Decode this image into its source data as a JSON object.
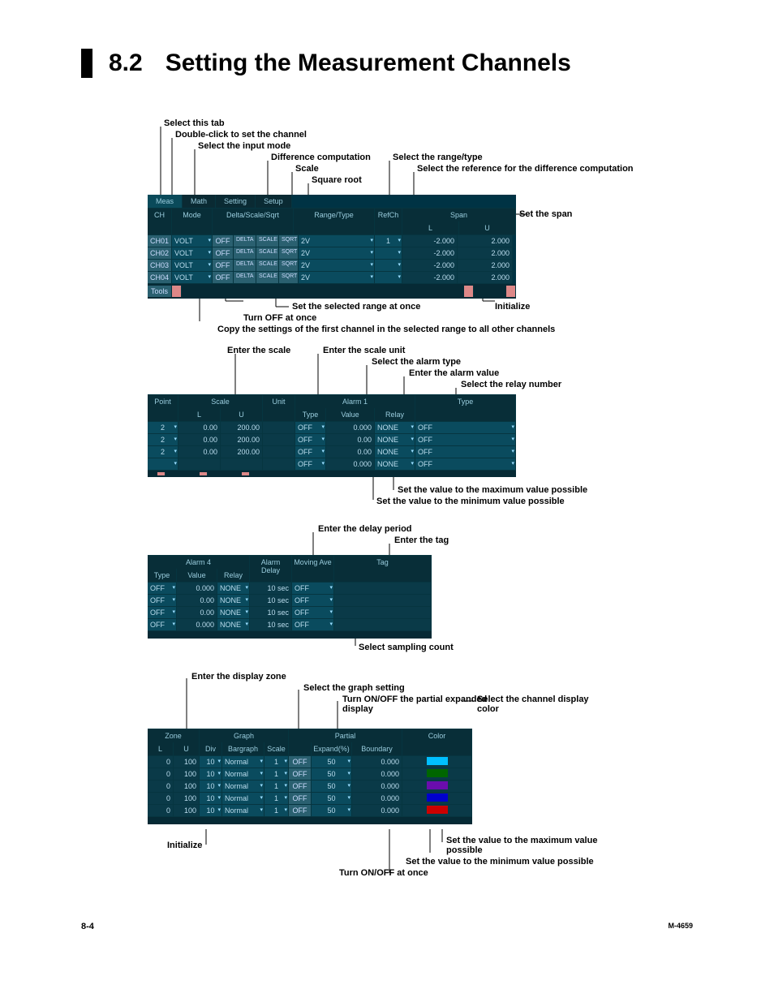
{
  "page": {
    "section_number": "8.2",
    "section_title": "Setting the Measurement Channels",
    "footer_left": "8-4",
    "footer_right": "M-4659"
  },
  "block1": {
    "annos": {
      "select_tab": "Select this tab",
      "dbl_click": "Double-click to set the channel",
      "input_mode": "Select the input mode",
      "diff_comp": "Difference computation",
      "scale": "Scale",
      "sqrt": "Square root",
      "range_type": "Select the range/type",
      "ref_diff": "Select the reference for the difference computation",
      "set_span": "Set the span",
      "set_sel_range": "Set the selected range at once",
      "turn_off": "Turn OFF at once",
      "copy": "Copy the settings of the first channel in the selected range to all other channels",
      "initialize": "Initialize"
    },
    "tabs": [
      "Meas",
      "Math",
      "Setting",
      "Setup"
    ],
    "headers": {
      "ch": "CH",
      "mode": "Mode",
      "delta": "Delta/Scale/Sqrt",
      "range": "Range/Type",
      "refch": "RefCh",
      "span": "Span",
      "span_l": "L",
      "span_u": "U"
    },
    "rows": [
      {
        "ch": "CH01",
        "mode": "VOLT",
        "off": "OFF",
        "delta": "DELTA",
        "scale": "SCALE",
        "sqrt": "SQRT",
        "range": "2V",
        "refch": "1",
        "l": "-2.000",
        "u": "2.000"
      },
      {
        "ch": "CH02",
        "mode": "VOLT",
        "off": "OFF",
        "delta": "DELTA",
        "scale": "SCALE",
        "sqrt": "SQRT",
        "range": "2V",
        "refch": "",
        "l": "-2.000",
        "u": "2.000"
      },
      {
        "ch": "CH03",
        "mode": "VOLT",
        "off": "OFF",
        "delta": "DELTA",
        "scale": "SCALE",
        "sqrt": "SQRT",
        "range": "2V",
        "refch": "",
        "l": "-2.000",
        "u": "2.000"
      },
      {
        "ch": "CH04",
        "mode": "VOLT",
        "off": "OFF",
        "delta": "DELTA",
        "scale": "SCALE",
        "sqrt": "SQRT",
        "range": "2V",
        "refch": "",
        "l": "-2.000",
        "u": "2.000"
      }
    ]
  },
  "block2": {
    "annos": {
      "enter_scale": "Enter the scale",
      "enter_unit": "Enter the scale unit",
      "alarm_type": "Select the alarm type",
      "alarm_value": "Enter the alarm value",
      "relay_num": "Select the relay number",
      "max_val": "Set the value to the maximum value possible",
      "min_val": "Set the value to the minimum value possible"
    },
    "headers": {
      "point": "Point",
      "scale": "Scale",
      "unit": "Unit",
      "alarm1": "Alarm 1",
      "l": "L",
      "u": "U",
      "type": "Type",
      "value": "Value",
      "relay": "Relay",
      "type2": "Type"
    },
    "rows": [
      {
        "pt": "2",
        "l": "0.00",
        "u": "200.00",
        "unit": "",
        "a1t": "OFF",
        "a1v": "0.000",
        "a1r": "NONE",
        "a2t": "OFF"
      },
      {
        "pt": "2",
        "l": "0.00",
        "u": "200.00",
        "unit": "",
        "a1t": "OFF",
        "a1v": "0.00",
        "a1r": "NONE",
        "a2t": "OFF"
      },
      {
        "pt": "2",
        "l": "0.00",
        "u": "200.00",
        "unit": "",
        "a1t": "OFF",
        "a1v": "0.00",
        "a1r": "NONE",
        "a2t": "OFF"
      },
      {
        "pt": "",
        "l": "",
        "u": "",
        "unit": "",
        "a1t": "OFF",
        "a1v": "0.000",
        "a1r": "NONE",
        "a2t": "OFF"
      }
    ]
  },
  "block3": {
    "annos": {
      "delay": "Enter the delay period",
      "tag": "Enter the tag",
      "sampling": "Select sampling count"
    },
    "headers": {
      "alarm4": "Alarm 4",
      "type": "Type",
      "value": "Value",
      "relay": "Relay",
      "delay": "Alarm Delay",
      "movavg": "Moving Ave",
      "tag": "Tag"
    },
    "rows": [
      {
        "t": "OFF",
        "v": "0.000",
        "r": "NONE",
        "d": "10 sec",
        "m": "OFF",
        "tag": ""
      },
      {
        "t": "OFF",
        "v": "0.00",
        "r": "NONE",
        "d": "10 sec",
        "m": "OFF",
        "tag": ""
      },
      {
        "t": "OFF",
        "v": "0.00",
        "r": "NONE",
        "d": "10 sec",
        "m": "OFF",
        "tag": ""
      },
      {
        "t": "OFF",
        "v": "0.000",
        "r": "NONE",
        "d": "10 sec",
        "m": "OFF",
        "tag": ""
      }
    ]
  },
  "block4": {
    "annos": {
      "zone": "Enter the display zone",
      "graph": "Select the graph setting",
      "partial": "Turn ON/OFF the partial expanded display",
      "color": "Select the channel display color",
      "initialize": "Initialize",
      "max": "Set the value to the maximum value possible",
      "min": "Set the value to the minimum value possible",
      "onoff": "Turn ON/OFF at once"
    },
    "headers": {
      "zone": "Zone",
      "graph": "Graph",
      "partial": "Partial",
      "color": "Color",
      "l": "L",
      "u": "U",
      "div": "Div",
      "bar": "Bargraph",
      "scale": "Scale",
      "exp": "Expand(%)",
      "bound": "Boundary"
    },
    "rows": [
      {
        "l": "0",
        "u": "100",
        "div": "10",
        "bar": "Normal",
        "scale": "1",
        "off": "OFF",
        "exp": "50",
        "bnd": "0.000",
        "color": "#00bfff"
      },
      {
        "l": "0",
        "u": "100",
        "div": "10",
        "bar": "Normal",
        "scale": "1",
        "off": "OFF",
        "exp": "50",
        "bnd": "0.000",
        "color": "#006600"
      },
      {
        "l": "0",
        "u": "100",
        "div": "10",
        "bar": "Normal",
        "scale": "1",
        "off": "OFF",
        "exp": "50",
        "bnd": "0.000",
        "color": "#6a0dad"
      },
      {
        "l": "0",
        "u": "100",
        "div": "10",
        "bar": "Normal",
        "scale": "1",
        "off": "OFF",
        "exp": "50",
        "bnd": "0.000",
        "color": "#0000cc"
      },
      {
        "l": "0",
        "u": "100",
        "div": "10",
        "bar": "Normal",
        "scale": "1",
        "off": "OFF",
        "exp": "50",
        "bnd": "0.000",
        "color": "#cc0000"
      }
    ]
  }
}
